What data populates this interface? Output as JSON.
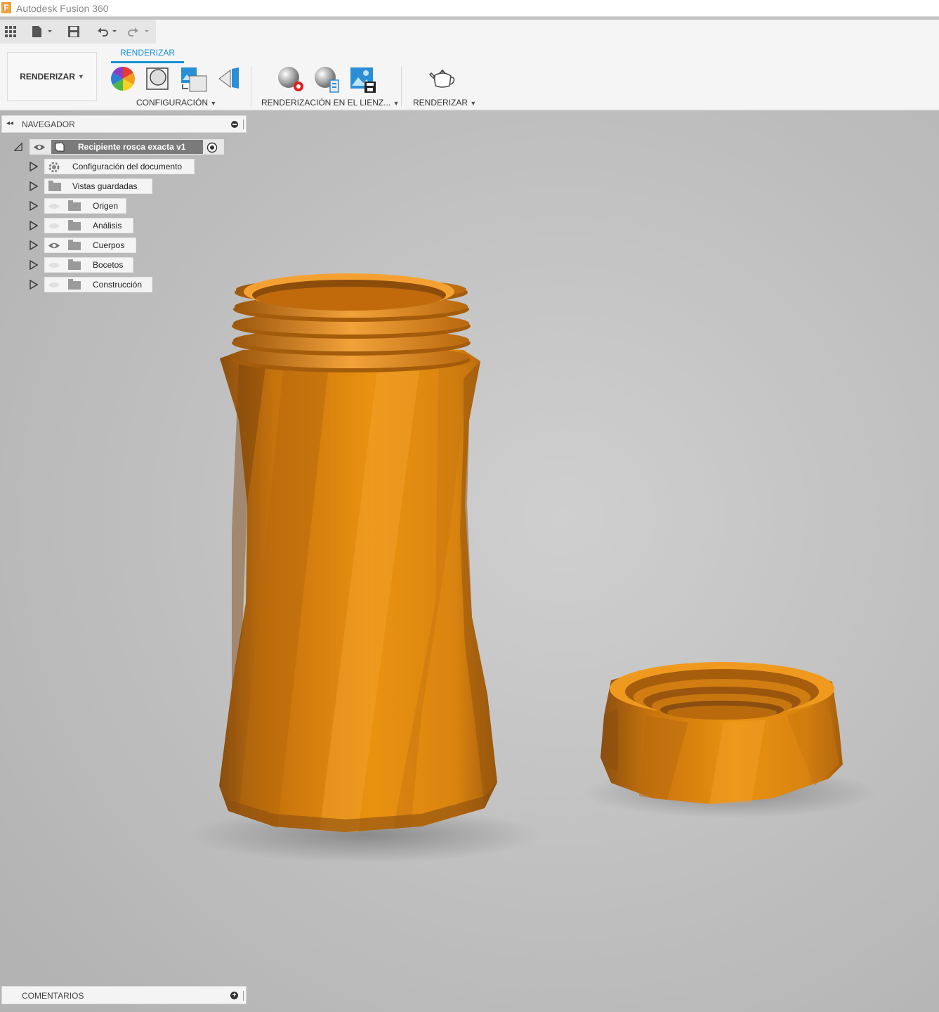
{
  "app": {
    "title": "Autodesk Fusion 360",
    "logo_letter": "F"
  },
  "ribbon": {
    "workspace_label": "RENDERIZAR",
    "active_tab": "RENDERIZAR",
    "groups": [
      {
        "label": "CONFIGURACIÓN"
      },
      {
        "label": "RENDERIZACIÓN EN EL LIENZ..."
      },
      {
        "label": "RENDERIZAR"
      }
    ]
  },
  "navigator": {
    "header": "NAVEGADOR",
    "root": "Recipiente rosca exacta v1",
    "items": [
      {
        "label": "Configuración del documento",
        "icon": "gear-icon"
      },
      {
        "label": "Vistas guardadas",
        "icon": "folder-icon"
      },
      {
        "label": "Origen",
        "icon": "folder-icon",
        "visible": false
      },
      {
        "label": "Análisis",
        "icon": "folder-icon",
        "visible": false
      },
      {
        "label": "Cuerpos",
        "icon": "folder-icon",
        "visible": true
      },
      {
        "label": "Bocetos",
        "icon": "folder-icon",
        "visible": false
      },
      {
        "label": "Construcción",
        "icon": "folder-icon",
        "visible": false
      }
    ]
  },
  "comments": {
    "label": "COMENTARIOS"
  },
  "colors": {
    "accent": "#1a8fd6",
    "model": "#e8900f",
    "viewport_bg": "#c4c4c4"
  }
}
